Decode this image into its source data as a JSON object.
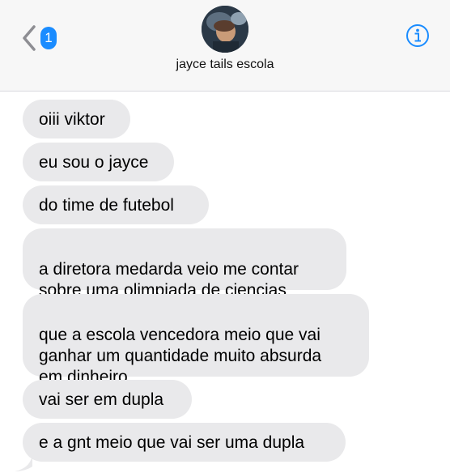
{
  "header": {
    "back_badge": "1",
    "contact_name": "jayce tails escola"
  },
  "icons": {
    "back": "chevron-left-icon",
    "info": "info-circle-icon",
    "avatar": "contact-avatar-photo"
  },
  "colors": {
    "accent": "#1a8cff",
    "bubble_received": "#e9e9eb",
    "header_bg": "#f7f7f7"
  },
  "messages": [
    {
      "text": "oiii viktor"
    },
    {
      "text": "eu sou o jayce"
    },
    {
      "text": "do time de futebol"
    },
    {
      "text": "a diretora medarda veio me contar\nsobre uma olimpiada de ciencias"
    },
    {
      "text": "que a escola vencedora meio que vai\nganhar um quantidade muito absurda\nem dinheiro"
    },
    {
      "text": "vai ser em dupla"
    },
    {
      "text": "e a gnt meio que vai ser uma dupla"
    }
  ]
}
